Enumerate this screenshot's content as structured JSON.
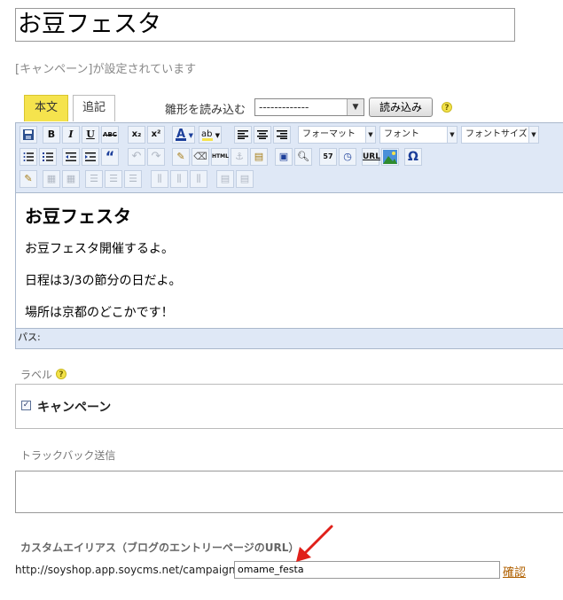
{
  "entry": {
    "title": "お豆フェスタ",
    "status_text": "[キャンペーン]が設定されています"
  },
  "tabs": {
    "main": "本文",
    "extra": "追記"
  },
  "template": {
    "label": "雛形を読み込む",
    "selected": "-------------",
    "load_button": "読み込み"
  },
  "toolbar": {
    "row1": [
      "save-icon",
      "bold-icon",
      "italic-icon",
      "underline-icon",
      "strikethrough-icon",
      "subscript-icon",
      "superscript-icon",
      "font-color-icon",
      "highlight-color-icon",
      "align-left-icon",
      "align-center-icon",
      "align-right-icon"
    ],
    "labels": {
      "bold": "B",
      "italic": "I",
      "underline": "U",
      "strike": "ABC",
      "sub": "x₂",
      "sup": "x²",
      "fontcolor": "A",
      "highlight": "ab"
    },
    "format_select": "フォーマット",
    "font_select": "フォント",
    "size_select": "フォントサイズ",
    "html_label": "HTML",
    "url_label": "URL",
    "omega_label": "Ω",
    "date_label": "57"
  },
  "content": {
    "heading": "お豆フェスタ",
    "paragraphs": [
      "お豆フェスタ開催するよ。",
      "日程は3/3の節分の日だよ。",
      "場所は京都のどこかです！"
    ]
  },
  "path_label": "パス:",
  "label_section": {
    "title": "ラベル",
    "items": [
      {
        "label": "キャンペーン",
        "checked": true
      }
    ]
  },
  "trackback": {
    "title": "トラックバック送信",
    "value": ""
  },
  "alias": {
    "title": "カスタムエイリアス（ブログのエントリーページのURL）",
    "url_prefix": "http://soyshop.app.soycms.net/campaign/",
    "value": "omame_festa",
    "confirm_link": "確認"
  },
  "colors": {
    "tab_active": "#f5e34d",
    "toolbar_bg": "#dfe8f6",
    "arrow": "#e0201a",
    "link": "#b06000"
  }
}
